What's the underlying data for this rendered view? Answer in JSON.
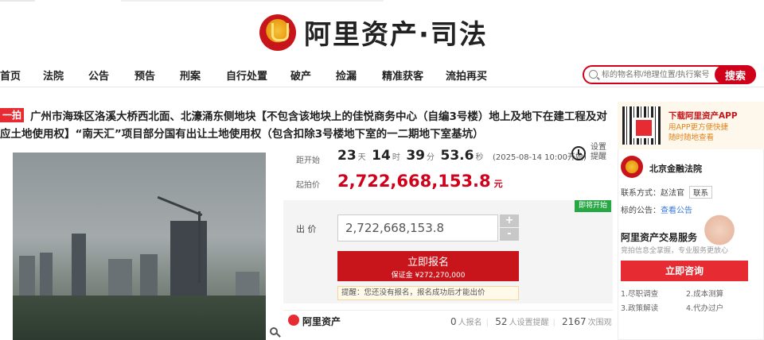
{
  "brand": {
    "name": "阿里资产·司法"
  },
  "nav": {
    "items": [
      "首页",
      "法院",
      "公告",
      "预告",
      "刑案",
      "自行处置",
      "破产",
      "捡漏",
      "精准获客",
      "流拍再买"
    ]
  },
  "search": {
    "placeholder": "标的物名称/地理位置/执行案号",
    "button": "搜索"
  },
  "item": {
    "badge": "一拍",
    "title": "广州市海珠区洛溪大桥西北面、北濠涌东侧地块【不包含该地块上的佳悦商务中心（自编3号楼）地上及地下在建工程及对应土地使用权】“南天汇”项目部分国有出让土地使用权（包含扣除3号楼地下室的一二期地下室基坑）"
  },
  "countdown": {
    "label": "距开始",
    "days": "23",
    "days_unit": "天",
    "hours": "14",
    "hours_unit": "时",
    "minutes": "39",
    "minutes_unit": "分",
    "seconds": "53.6",
    "seconds_unit": "秒",
    "start_note": "(2025-08-14 10:00开始)"
  },
  "reminder": {
    "label": "设置提醒"
  },
  "start_price": {
    "label": "起拍价",
    "value": "2,722,668,153.8",
    "unit": "元"
  },
  "bid": {
    "tag": "即将开始",
    "label": "出 价",
    "value": "2,722,668,153.8",
    "plus": "+",
    "minus": "-",
    "register_label": "立即报名",
    "deposit": "保证金 ¥272,270,000",
    "tip": "提醒：您还没有报名，报名成功后才能出价"
  },
  "platform": {
    "name": "阿里资产",
    "registered_count": "0",
    "registered_label": "人报名",
    "reminder_count": "52",
    "reminder_label": "人设置提醒",
    "views_count": "2167",
    "views_label": "次围观"
  },
  "app": {
    "title": "下载阿里资产APP",
    "desc1": "用APP更方便快捷",
    "desc2": "随时随地查看"
  },
  "court": {
    "name": "北京金融法院",
    "contact_label": "联系方式：赵法官",
    "contact_button": "联系",
    "notice_label": "标的公告：",
    "notice_link": "查看公告"
  },
  "service": {
    "title": "阿里资产交易服务",
    "desc": "竞拍信息全掌握，专业服务更放心",
    "consult_button": "立即咨询",
    "links": [
      "1.尽职调查",
      "2.成本测算",
      "3.政策解读",
      "4.代办过户"
    ]
  },
  "colors": {
    "accent": "#d0021b",
    "green": "#28a745",
    "link": "#3a7ad8"
  }
}
